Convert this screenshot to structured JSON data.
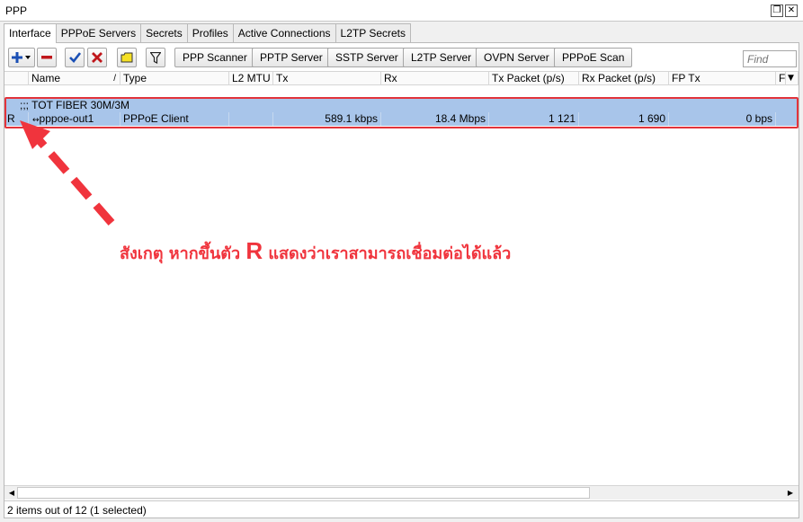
{
  "window": {
    "title": "PPP"
  },
  "tabs": [
    {
      "label": "Interface",
      "active": true
    },
    {
      "label": "PPPoE Servers"
    },
    {
      "label": "Secrets"
    },
    {
      "label": "Profiles"
    },
    {
      "label": "Active Connections"
    },
    {
      "label": "L2TP Secrets"
    }
  ],
  "toolbar": {
    "buttons": [
      "PPP Scanner",
      "PPTP Server",
      "SSTP Server",
      "L2TP Server",
      "OVPN Server",
      "PPPoE Scan"
    ],
    "find_placeholder": "Find",
    "colors": {
      "add": "#1a4fb5",
      "remove": "#c0161b",
      "enable": "#1a4fb5",
      "disable": "#c0161b",
      "comment": "#f5e025"
    }
  },
  "columns": [
    "Name",
    "Type",
    "L2 MTU",
    "Tx",
    "Rx",
    "Tx Packet (p/s)",
    "Rx Packet (p/s)",
    "FP Tx",
    "F"
  ],
  "rows": {
    "comment": ";;; TOT FIBER 30M/3M",
    "flag": "R",
    "name": "pppoe-out1",
    "type": "PPPoE Client",
    "l2mtu": "",
    "tx": "589.1 kbps",
    "rx": "18.4 Mbps",
    "tx_packet": "1 121",
    "rx_packet": "1 690",
    "fp_tx": "0 bps"
  },
  "status": "2 items out of 12 (1 selected)",
  "annotation": {
    "prefix": "สังเกตุ หากขึ้นตัว",
    "letter": "R",
    "suffix": "แสดงว่าเราสามารถเชื่อมต่อได้แล้ว",
    "color": "#f0343d"
  }
}
